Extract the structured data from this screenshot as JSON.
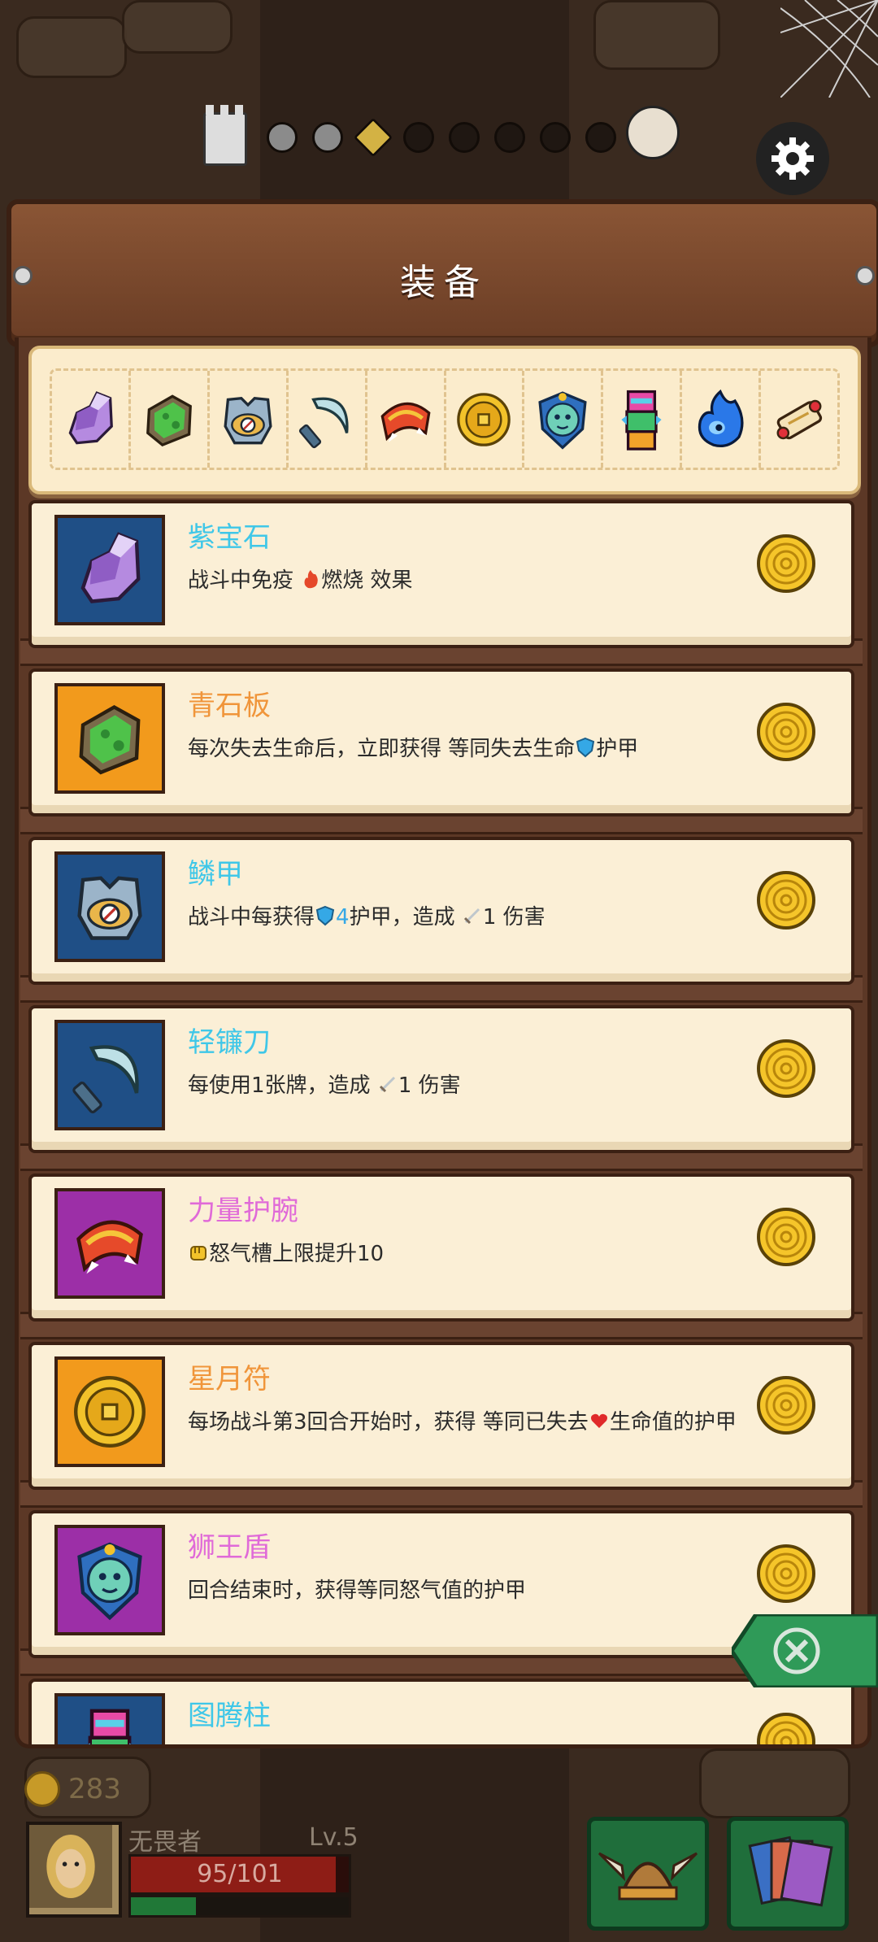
{
  "panel": {
    "title": "装备"
  },
  "progress": {
    "nodes": [
      "done",
      "done",
      "current",
      "todo",
      "todo",
      "todo",
      "todo",
      "todo",
      "todo"
    ]
  },
  "strip_icons": [
    "amethyst-icon",
    "green-slab-icon",
    "scale-armor-icon",
    "sickle-icon",
    "bracer-icon",
    "talisman-coin-icon",
    "lion-shield-icon",
    "totem-icon",
    "blue-flame-icon",
    "scroll-icon"
  ],
  "cards": [
    {
      "name": "紫宝石",
      "name_color": "#3fc7e8",
      "bg": "#1f4f86",
      "desc_parts": [
        "战斗中免疫 ",
        "燃烧",
        " 效果"
      ],
      "icon": "amethyst-icon"
    },
    {
      "name": "青石板",
      "name_color": "#f0953a",
      "bg": "#f29a1c",
      "desc_parts": [
        "每次失去生命后，立即获得 等同失去生命",
        "护甲"
      ],
      "icon": "green-slab-icon"
    },
    {
      "name": "鳞甲",
      "name_color": "#3fc7e8",
      "bg": "#1f4f86",
      "desc_parts": [
        "战斗中每获得",
        "4",
        "护甲，造成 ",
        "1 伤害"
      ],
      "icon": "scale-armor-icon"
    },
    {
      "name": "轻镰刀",
      "name_color": "#3fc7e8",
      "bg": "#1f4f86",
      "desc_parts": [
        "每使用1张牌，造成 ",
        "1 伤害"
      ],
      "icon": "sickle-icon"
    },
    {
      "name": "力量护腕",
      "name_color": "#e06ad8",
      "bg": "#9c2fa7",
      "desc_parts": [
        "怒气槽上限提升10"
      ],
      "icon": "bracer-icon"
    },
    {
      "name": "星月符",
      "name_color": "#f0953a",
      "bg": "#f29a1c",
      "desc_parts": [
        "每场战斗第3回合开始时，获得 等同已失去",
        "生命值的护甲"
      ],
      "icon": "talisman-coin-icon"
    },
    {
      "name": "狮王盾",
      "name_color": "#e06ad8",
      "bg": "#9c2fa7",
      "desc_parts": [
        "回合结束时，获得等同怒气值的护甲"
      ],
      "icon": "lion-shield-icon"
    },
    {
      "name": "图腾柱",
      "name_color": "#3fc7e8",
      "bg": "#1f4f86",
      "desc_parts": [
        ""
      ],
      "icon": "totem-icon"
    }
  ],
  "hud": {
    "gold": "283",
    "hero_name": "无畏者",
    "level": "Lv.5",
    "hp": "95/101",
    "hp_fraction": 0.94,
    "xp_fraction": 0.3
  }
}
